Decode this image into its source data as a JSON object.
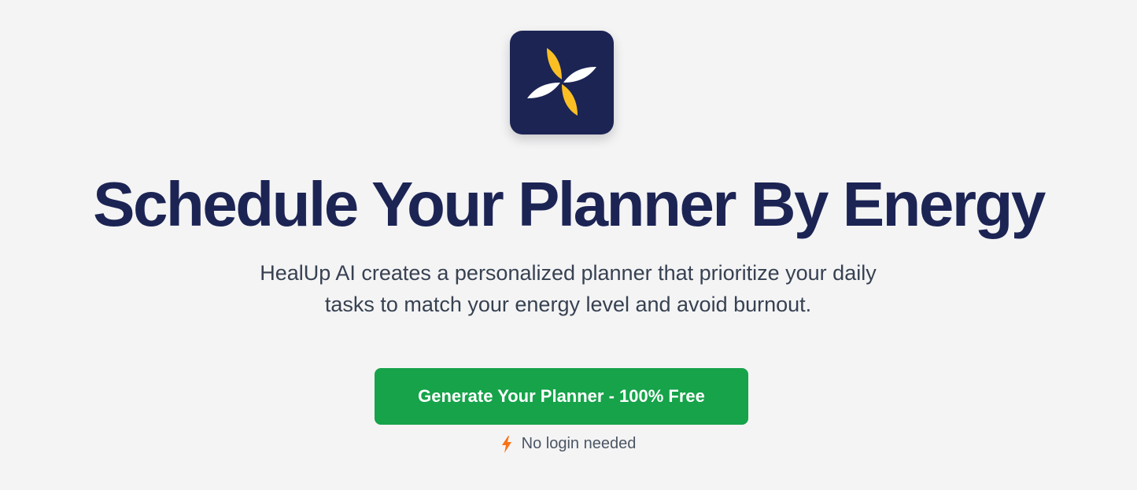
{
  "colors": {
    "background": "#f4f4f5",
    "logo_bg": "#1c2454",
    "logo_accent": "#fbbf24",
    "logo_light": "#ffffff",
    "headline": "#1c2454",
    "cta_bg": "#16a34a",
    "bolt": "#f97316"
  },
  "logo": {
    "icon": "pinwheel-leaf-icon"
  },
  "hero": {
    "headline": "Schedule Your Planner By Energy",
    "subtitle_line1": "HealUp AI creates a personalized planner that prioritize your daily",
    "subtitle_line2": "tasks to match your energy level and avoid burnout."
  },
  "cta": {
    "label": "Generate Your Planner - 100% Free"
  },
  "note": {
    "icon": "lightning-bolt-icon",
    "text": "No login needed"
  }
}
